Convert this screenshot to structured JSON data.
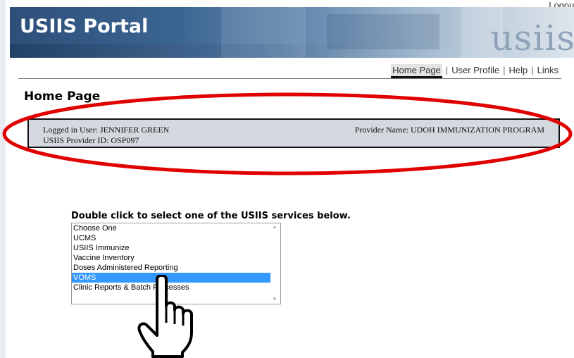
{
  "header": {
    "logout": "Logout",
    "app_title": "USIIS Portal",
    "logo_text": "usiis"
  },
  "nav": {
    "items": [
      "Home Page",
      "User Profile",
      "Help",
      "Links"
    ],
    "separator": "|"
  },
  "page_title": "Home Page",
  "user_info": {
    "logged_in_user": "Logged in User: JENNIFER GREEN",
    "provider_id": "USIIS Provider ID: OSP097",
    "provider_name": "Provider Name: UDOH IMMUNIZATION PROGRAM"
  },
  "services": {
    "prompt": "Double click to select one of the USIIS services below.",
    "options": [
      "Choose One",
      "UCMS",
      "USIIS Immunize",
      "Vaccine Inventory",
      "Doses Administered Reporting",
      "VOMS",
      "Clinic Reports & Batch Processes"
    ],
    "selected": "VOMS"
  },
  "colors": {
    "annotation": "#e00000",
    "selection": "#3399ff",
    "info_box": "#d4d9df"
  },
  "icons": {
    "cursor": "pointing-hand-icon"
  }
}
